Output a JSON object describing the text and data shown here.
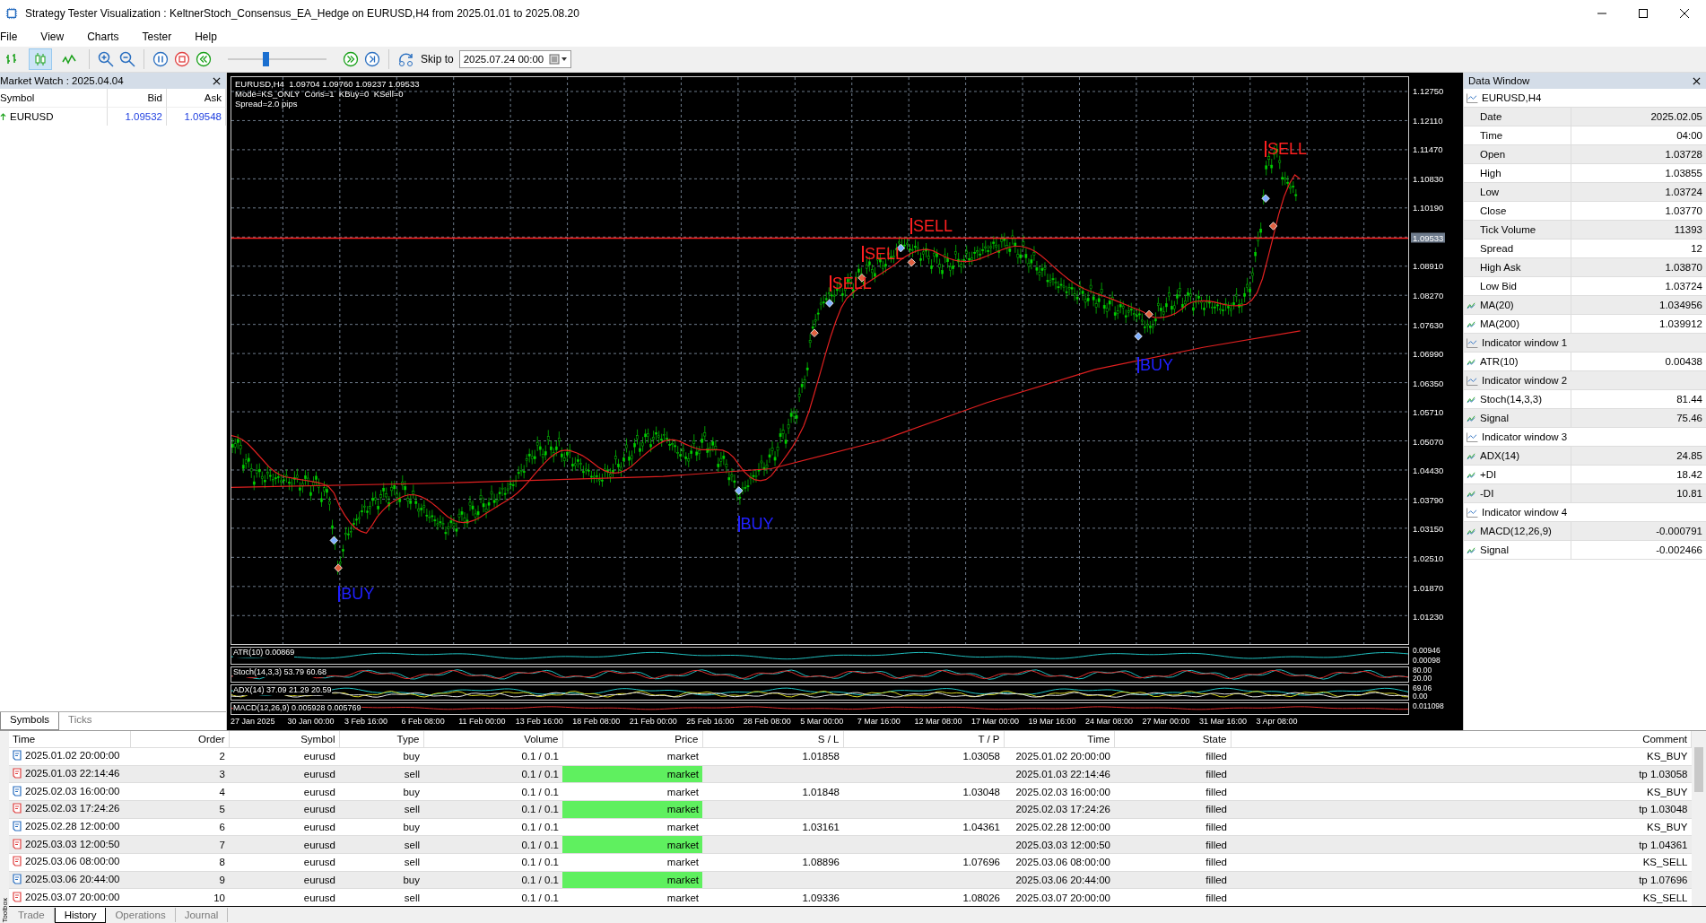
{
  "window": {
    "title": "Strategy Tester Visualization : KeltnerStoch_Consensus_EA_Hedge on EURUSD,H4 from 2025.01.01 to 2025.08.20"
  },
  "menu": [
    "File",
    "View",
    "Charts",
    "Tester",
    "Help"
  ],
  "toolbar": {
    "chart_modes": [
      {
        "kind": "bars",
        "selected": false
      },
      {
        "kind": "candles",
        "selected": true
      },
      {
        "kind": "line",
        "selected": false
      }
    ],
    "speed": {
      "level": 0.38
    },
    "skip_label": "Skip to",
    "skip_date": "2025.07.24 00:00"
  },
  "market_watch": {
    "title": "Market Watch : 2025.04.04",
    "columns": [
      "Symbol",
      "Bid",
      "Ask"
    ],
    "rows": [
      {
        "symbol": "EURUSD",
        "bid": "1.09532",
        "ask": "1.09548"
      }
    ],
    "tabs": [
      {
        "label": "Symbols",
        "selected": true
      },
      {
        "label": "Ticks",
        "selected": false
      }
    ]
  },
  "chart": {
    "header": [
      "EURUSD,H4  1.09704 1.09760 1.09237 1.09533",
      "Mode=KS_ONLY  Cons=1  KBuy=0  KSell=0",
      "Spread=2.0 pips"
    ],
    "price_ticks": [
      "1.12750",
      "1.12110",
      "1.11470",
      "1.10830",
      "1.10190",
      "1.08910",
      "1.08270",
      "1.07630",
      "1.06990",
      "1.06350",
      "1.05710",
      "1.05070",
      "1.04430",
      "1.03790",
      "1.03150",
      "1.02510",
      "1.01870",
      "1.01230"
    ],
    "current_price": "1.09533",
    "signals": [
      {
        "label": "SELL",
        "kind": "sell"
      },
      {
        "label": "SELL",
        "kind": "sell"
      },
      {
        "label": "SELL",
        "kind": "sell"
      },
      {
        "label": "SELL",
        "kind": "sell"
      },
      {
        "label": "BUY",
        "kind": "buy"
      },
      {
        "label": "BUY",
        "kind": "buy"
      },
      {
        "label": "BUY",
        "kind": "buy"
      }
    ],
    "indicators": [
      {
        "label": "ATR(10) 0.00869",
        "scale": [
          "0.00946",
          "0.00098"
        ]
      },
      {
        "label": "Stoch(14,3,3) 53.79 60.68",
        "scale": [
          "80.00",
          "20.00"
        ]
      },
      {
        "label": "ADX(14) 37.09 21.29 20.59",
        "scale": [
          "69.06",
          "0.00"
        ]
      },
      {
        "label": "MACD(12,26,9) 0.005928 0.005769",
        "scale": [
          "0.011098"
        ]
      }
    ],
    "time_ticks": [
      "27 Jan 2025",
      "30 Jan 00:00",
      "3 Feb 16:00",
      "6 Feb 08:00",
      "11 Feb 00:00",
      "13 Feb 16:00",
      "18 Feb 08:00",
      "21 Feb 00:00",
      "25 Feb 16:00",
      "28 Feb 08:00",
      "5 Mar 00:00",
      "7 Mar 16:00",
      "12 Mar 08:00",
      "17 Mar 00:00",
      "19 Mar 16:00",
      "24 Mar 08:00",
      "27 Mar 00:00",
      "31 Mar 16:00",
      "3 Apr 08:00"
    ]
  },
  "data_window": {
    "title": "Data Window",
    "rows": [
      {
        "kind": "group",
        "label": "EURUSD,H4"
      },
      {
        "kind": "field",
        "label": "Date",
        "value": "2025.02.05"
      },
      {
        "kind": "field",
        "label": "Time",
        "value": "04:00"
      },
      {
        "kind": "field",
        "label": "Open",
        "value": "1.03728"
      },
      {
        "kind": "field",
        "label": "High",
        "value": "1.03855"
      },
      {
        "kind": "field",
        "label": "Low",
        "value": "1.03724"
      },
      {
        "kind": "field",
        "label": "Close",
        "value": "1.03770"
      },
      {
        "kind": "field",
        "label": "Tick Volume",
        "value": "11393"
      },
      {
        "kind": "field",
        "label": "Spread",
        "value": "12"
      },
      {
        "kind": "field",
        "label": "High Ask",
        "value": "1.03870"
      },
      {
        "kind": "field",
        "label": "Low Bid",
        "value": "1.03724"
      },
      {
        "kind": "indicator",
        "label": "MA(20)",
        "value": "1.034956"
      },
      {
        "kind": "indicator",
        "label": "MA(200)",
        "value": "1.039912"
      },
      {
        "kind": "group",
        "label": "Indicator window 1"
      },
      {
        "kind": "indicator",
        "label": "ATR(10)",
        "value": "0.00438"
      },
      {
        "kind": "group",
        "label": "Indicator window 2"
      },
      {
        "kind": "indicator",
        "label": "Stoch(14,3,3)",
        "value": "81.44"
      },
      {
        "kind": "indicator",
        "label": "Signal",
        "value": "75.46"
      },
      {
        "kind": "group",
        "label": "Indicator window 3"
      },
      {
        "kind": "indicator",
        "label": "ADX(14)",
        "value": "24.85"
      },
      {
        "kind": "indicator",
        "label": "+DI",
        "value": "18.42"
      },
      {
        "kind": "indicator",
        "label": "-DI",
        "value": "10.81"
      },
      {
        "kind": "group",
        "label": "Indicator window 4"
      },
      {
        "kind": "indicator",
        "label": "MACD(12,26,9)",
        "value": "-0.000791"
      },
      {
        "kind": "indicator",
        "label": "Signal",
        "value": "-0.002466"
      }
    ]
  },
  "orders": {
    "columns": [
      "Time",
      "Order",
      "Symbol",
      "Type",
      "Volume",
      "Price",
      "S / L",
      "T / P",
      "Time",
      "State",
      "Comment"
    ],
    "rows": [
      {
        "kind": "buy",
        "highlighted": false,
        "cells": [
          "2025.01.02 20:00:00",
          "2",
          "eurusd",
          "buy",
          "0.1 / 0.1",
          "market",
          "1.01858",
          "1.03058",
          "2025.01.02 20:00:00",
          "filled",
          "KS_BUY"
        ]
      },
      {
        "kind": "sell",
        "highlighted": true,
        "cells": [
          "2025.01.03 22:14:46",
          "3",
          "eurusd",
          "sell",
          "0.1 / 0.1",
          "market",
          "",
          "",
          "2025.01.03 22:14:46",
          "filled",
          "tp 1.03058"
        ]
      },
      {
        "kind": "buy",
        "highlighted": false,
        "cells": [
          "2025.02.03 16:00:00",
          "4",
          "eurusd",
          "buy",
          "0.1 / 0.1",
          "market",
          "1.01848",
          "1.03048",
          "2025.02.03 16:00:00",
          "filled",
          "KS_BUY"
        ]
      },
      {
        "kind": "sell",
        "highlighted": true,
        "cells": [
          "2025.02.03 17:24:26",
          "5",
          "eurusd",
          "sell",
          "0.1 / 0.1",
          "market",
          "",
          "",
          "2025.02.03 17:24:26",
          "filled",
          "tp 1.03048"
        ]
      },
      {
        "kind": "buy",
        "highlighted": false,
        "cells": [
          "2025.02.28 12:00:00",
          "6",
          "eurusd",
          "buy",
          "0.1 / 0.1",
          "market",
          "1.03161",
          "1.04361",
          "2025.02.28 12:00:00",
          "filled",
          "KS_BUY"
        ]
      },
      {
        "kind": "sell",
        "highlighted": true,
        "cells": [
          "2025.03.03 12:00:50",
          "7",
          "eurusd",
          "sell",
          "0.1 / 0.1",
          "market",
          "",
          "",
          "2025.03.03 12:00:50",
          "filled",
          "tp 1.04361"
        ]
      },
      {
        "kind": "sell",
        "highlighted": false,
        "cells": [
          "2025.03.06 08:00:00",
          "8",
          "eurusd",
          "sell",
          "0.1 / 0.1",
          "market",
          "1.08896",
          "1.07696",
          "2025.03.06 08:00:00",
          "filled",
          "KS_SELL"
        ]
      },
      {
        "kind": "buy",
        "highlighted": true,
        "cells": [
          "2025.03.06 20:44:00",
          "9",
          "eurusd",
          "buy",
          "0.1 / 0.1",
          "market",
          "",
          "",
          "2025.03.06 20:44:00",
          "filled",
          "tp 1.07696"
        ]
      },
      {
        "kind": "sell",
        "highlighted": false,
        "cells": [
          "2025.03.07 20:00:00",
          "10",
          "eurusd",
          "sell",
          "0.1 / 0.1",
          "market",
          "1.09336",
          "1.08026",
          "2025.03.07 20:00:00",
          "filled",
          "KS_SELL"
        ]
      }
    ]
  },
  "toolbox_label": "Toolbox",
  "bottom_tabs": [
    {
      "label": "Trade",
      "selected": false
    },
    {
      "label": "History",
      "selected": true
    },
    {
      "label": "Operations",
      "selected": false
    },
    {
      "label": "Journal",
      "selected": false
    }
  ]
}
